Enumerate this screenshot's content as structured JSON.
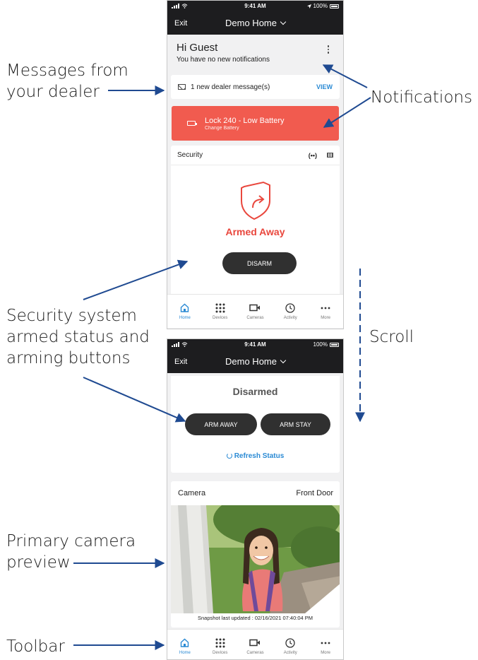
{
  "annotations": {
    "messages": [
      "Messages from",
      "your dealer"
    ],
    "notifications": "Notifications",
    "security": [
      "Security system",
      "armed status and",
      "arming buttons"
    ],
    "scroll": "Scroll",
    "camera": [
      "Primary camera",
      "preview"
    ],
    "toolbar": "Toolbar"
  },
  "status_bar_top": {
    "time": "9:41 AM",
    "battery": "100%"
  },
  "status_bar_bottom": {
    "time": "9:41 AM",
    "battery": "100%"
  },
  "app_bar": {
    "exit_label": "Exit",
    "home_name": "Demo Home"
  },
  "greeting": {
    "title": "Hi Guest",
    "subtitle": "You have no new notifications"
  },
  "dealer_message": {
    "text": "1 new dealer message(s)",
    "action": "VIEW"
  },
  "alert": {
    "title": "Lock 240 - Low Battery",
    "subtitle": "Change Battery",
    "color": "#f15b4f"
  },
  "security": {
    "title": "Security",
    "signal_icon": "(••)",
    "status": "Armed Away",
    "disarm_label": "DISARM",
    "status_color": "#e9473d"
  },
  "security_bottom": {
    "status": "Disarmed",
    "arm_away_label": "ARM AWAY",
    "arm_stay_label": "ARM STAY",
    "refresh_label": "Refresh Status"
  },
  "camera": {
    "title": "Camera",
    "name": "Front Door",
    "snapshot_label": "Snapshot last updated : 02/16/2021 07:40:04 PM"
  },
  "toolbar": {
    "tabs": [
      "Home",
      "Devices",
      "Cameras",
      "Activity",
      "More"
    ],
    "accent": "#2a8ad4"
  },
  "icons": [
    "signal-icon",
    "wifi-icon",
    "location-icon",
    "battery-icon",
    "chevron-down-icon",
    "kebab-menu-icon",
    "envelope-icon",
    "low-battery-icon",
    "signal-broadcast-icon",
    "keypad-icon",
    "shield-arrow-icon",
    "refresh-icon",
    "home-icon",
    "grid-icon",
    "camera-icon",
    "clock-icon",
    "more-icon"
  ]
}
